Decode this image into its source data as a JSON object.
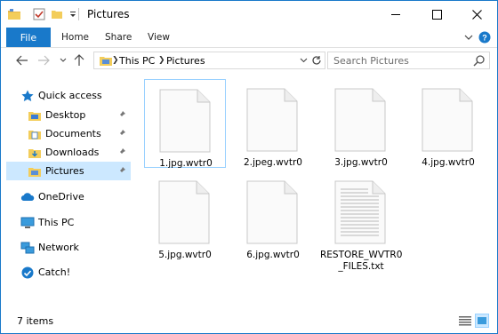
{
  "window": {
    "title": "Pictures"
  },
  "ribbon": {
    "tabs": [
      "File",
      "Home",
      "Share",
      "View"
    ]
  },
  "address": {
    "crumbs": [
      "This PC",
      "Pictures"
    ]
  },
  "search": {
    "placeholder": "Search Pictures"
  },
  "sidebar": {
    "items": [
      {
        "label": "Quick access",
        "icon": "star-icon"
      },
      {
        "label": "Desktop",
        "icon": "folder-icon",
        "pinned": true
      },
      {
        "label": "Documents",
        "icon": "folder-icon",
        "pinned": true
      },
      {
        "label": "Downloads",
        "icon": "download-folder-icon",
        "pinned": true
      },
      {
        "label": "Pictures",
        "icon": "folder-icon",
        "pinned": true,
        "selected": true
      },
      {
        "label": "OneDrive",
        "icon": "cloud-icon"
      },
      {
        "label": "This PC",
        "icon": "computer-icon"
      },
      {
        "label": "Network",
        "icon": "network-icon"
      },
      {
        "label": "Catch!",
        "icon": "catch-icon"
      }
    ]
  },
  "files": [
    {
      "name": "1.jpg.wvtr0"
    },
    {
      "name": "2.jpeg.wvtr0"
    },
    {
      "name": "3.jpg.wvtr0"
    },
    {
      "name": "4.jpg.wvtr0"
    },
    {
      "name": "5.jpg.wvtr0"
    },
    {
      "name": "6.jpg.wvtr0"
    },
    {
      "name": "RESTORE_WVTR0\n_FILES.txt",
      "lines": [
        "RESTORE_WVTR0",
        "_FILES.txt"
      ]
    }
  ],
  "status": {
    "item_count": "7 items"
  },
  "colors": {
    "accent": "#1979ca",
    "selected": "#cce8ff",
    "outline": "#99d1ff"
  }
}
